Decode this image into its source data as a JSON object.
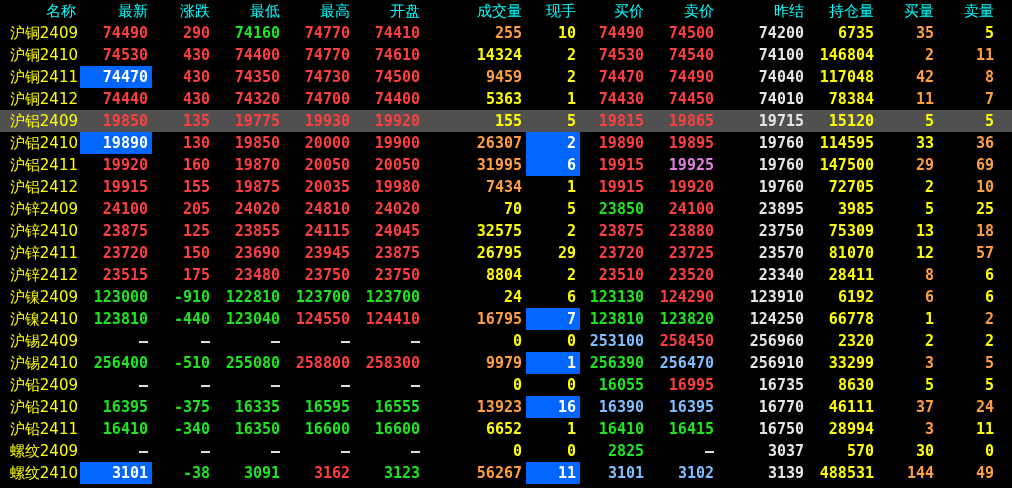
{
  "columns": [
    "名称",
    "最新",
    "涨跌",
    "最低",
    "最高",
    "开盘",
    "成交量",
    "现手",
    "买价",
    "卖价",
    "昨结",
    "持仓量",
    "买量",
    "卖量"
  ],
  "rows": [
    {
      "name": "沪铜2409",
      "selected": false,
      "cells": [
        {
          "text": "74490",
          "color": "#ff3f3f",
          "highlighted": false
        },
        {
          "text": "290",
          "color": "#ff3f3f",
          "highlighted": false
        },
        {
          "text": "74160",
          "color": "#1ee61e",
          "highlighted": false
        },
        {
          "text": "74770",
          "color": "#ff3f3f",
          "highlighted": false
        },
        {
          "text": "74410",
          "color": "#ff3f3f",
          "highlighted": false
        },
        {
          "text": "255",
          "color": "#ff9f40",
          "highlighted": false
        },
        {
          "text": "10",
          "color": "#ffff00",
          "highlighted": false
        },
        {
          "text": "74490",
          "color": "#ff3f3f",
          "highlighted": false
        },
        {
          "text": "74500",
          "color": "#ff3f3f",
          "highlighted": false
        },
        {
          "text": "74200",
          "color": "#e6e6e6",
          "highlighted": false
        },
        {
          "text": "6735",
          "color": "#ffff00",
          "highlighted": false
        },
        {
          "text": "35",
          "color": "#ff9f40",
          "highlighted": false
        },
        {
          "text": "5",
          "color": "#ffff00",
          "highlighted": false
        }
      ]
    },
    {
      "name": "沪铜2410",
      "selected": false,
      "cells": [
        {
          "text": "74530",
          "color": "#ff3f3f",
          "highlighted": false
        },
        {
          "text": "430",
          "color": "#ff3f3f",
          "highlighted": false
        },
        {
          "text": "74400",
          "color": "#ff3f3f",
          "highlighted": false
        },
        {
          "text": "74770",
          "color": "#ff3f3f",
          "highlighted": false
        },
        {
          "text": "74610",
          "color": "#ff3f3f",
          "highlighted": false
        },
        {
          "text": "14324",
          "color": "#ffff00",
          "highlighted": false
        },
        {
          "text": "2",
          "color": "#ffff00",
          "highlighted": false
        },
        {
          "text": "74530",
          "color": "#ff3f3f",
          "highlighted": false
        },
        {
          "text": "74540",
          "color": "#ff3f3f",
          "highlighted": false
        },
        {
          "text": "74100",
          "color": "#e6e6e6",
          "highlighted": false
        },
        {
          "text": "146804",
          "color": "#ffff00",
          "highlighted": false
        },
        {
          "text": "2",
          "color": "#ff9f40",
          "highlighted": false
        },
        {
          "text": "11",
          "color": "#ff9f40",
          "highlighted": false
        }
      ]
    },
    {
      "name": "沪铜2411",
      "selected": false,
      "cells": [
        {
          "text": "74470",
          "color": "#ffffff",
          "highlighted": true
        },
        {
          "text": "430",
          "color": "#ff3f3f",
          "highlighted": false
        },
        {
          "text": "74350",
          "color": "#ff3f3f",
          "highlighted": false
        },
        {
          "text": "74730",
          "color": "#ff3f3f",
          "highlighted": false
        },
        {
          "text": "74500",
          "color": "#ff3f3f",
          "highlighted": false
        },
        {
          "text": "9459",
          "color": "#ff9f40",
          "highlighted": false
        },
        {
          "text": "2",
          "color": "#ffff00",
          "highlighted": false
        },
        {
          "text": "74470",
          "color": "#ff3f3f",
          "highlighted": false
        },
        {
          "text": "74490",
          "color": "#ff3f3f",
          "highlighted": false
        },
        {
          "text": "74040",
          "color": "#e6e6e6",
          "highlighted": false
        },
        {
          "text": "117048",
          "color": "#ffff00",
          "highlighted": false
        },
        {
          "text": "42",
          "color": "#ff9f40",
          "highlighted": false
        },
        {
          "text": "8",
          "color": "#ff9f40",
          "highlighted": false
        }
      ]
    },
    {
      "name": "沪铜2412",
      "selected": false,
      "cells": [
        {
          "text": "74440",
          "color": "#ff3f3f",
          "highlighted": false
        },
        {
          "text": "430",
          "color": "#ff3f3f",
          "highlighted": false
        },
        {
          "text": "74320",
          "color": "#ff3f3f",
          "highlighted": false
        },
        {
          "text": "74700",
          "color": "#ff3f3f",
          "highlighted": false
        },
        {
          "text": "74400",
          "color": "#ff3f3f",
          "highlighted": false
        },
        {
          "text": "5363",
          "color": "#ffff00",
          "highlighted": false
        },
        {
          "text": "1",
          "color": "#ffff00",
          "highlighted": false
        },
        {
          "text": "74430",
          "color": "#ff3f3f",
          "highlighted": false
        },
        {
          "text": "74450",
          "color": "#ff3f3f",
          "highlighted": false
        },
        {
          "text": "74010",
          "color": "#e6e6e6",
          "highlighted": false
        },
        {
          "text": "78384",
          "color": "#ffff00",
          "highlighted": false
        },
        {
          "text": "11",
          "color": "#ff9f40",
          "highlighted": false
        },
        {
          "text": "7",
          "color": "#ff9f40",
          "highlighted": false
        }
      ]
    },
    {
      "name": "沪铝2409",
      "selected": true,
      "cells": [
        {
          "text": "19850",
          "color": "#ff3f3f",
          "highlighted": false
        },
        {
          "text": "135",
          "color": "#ff3f3f",
          "highlighted": false
        },
        {
          "text": "19775",
          "color": "#ff3f3f",
          "highlighted": false
        },
        {
          "text": "19930",
          "color": "#ff3f3f",
          "highlighted": false
        },
        {
          "text": "19920",
          "color": "#ff3f3f",
          "highlighted": false
        },
        {
          "text": "155",
          "color": "#ffff00",
          "highlighted": false
        },
        {
          "text": "5",
          "color": "#ffff00",
          "highlighted": false
        },
        {
          "text": "19815",
          "color": "#ff3f3f",
          "highlighted": false
        },
        {
          "text": "19865",
          "color": "#ff3f3f",
          "highlighted": false
        },
        {
          "text": "19715",
          "color": "#e6e6e6",
          "highlighted": false
        },
        {
          "text": "15120",
          "color": "#ffff00",
          "highlighted": false
        },
        {
          "text": "5",
          "color": "#ffff00",
          "highlighted": false
        },
        {
          "text": "5",
          "color": "#ffff00",
          "highlighted": false
        }
      ]
    },
    {
      "name": "沪铝2410",
      "selected": false,
      "cells": [
        {
          "text": "19890",
          "color": "#ffffff",
          "highlighted": true
        },
        {
          "text": "130",
          "color": "#ff3f3f",
          "highlighted": false
        },
        {
          "text": "19850",
          "color": "#ff3f3f",
          "highlighted": false
        },
        {
          "text": "20000",
          "color": "#ff3f3f",
          "highlighted": false
        },
        {
          "text": "19900",
          "color": "#ff3f3f",
          "highlighted": false
        },
        {
          "text": "26307",
          "color": "#ff9f40",
          "highlighted": false
        },
        {
          "text": "2",
          "color": "#ffffff",
          "highlighted": true
        },
        {
          "text": "19890",
          "color": "#ff3f3f",
          "highlighted": false
        },
        {
          "text": "19895",
          "color": "#ff3f3f",
          "highlighted": false
        },
        {
          "text": "19760",
          "color": "#e6e6e6",
          "highlighted": false
        },
        {
          "text": "114595",
          "color": "#ffff00",
          "highlighted": false
        },
        {
          "text": "33",
          "color": "#ffff00",
          "highlighted": false
        },
        {
          "text": "36",
          "color": "#ff9f40",
          "highlighted": false
        }
      ]
    },
    {
      "name": "沪铝2411",
      "selected": false,
      "cells": [
        {
          "text": "19920",
          "color": "#ff3f3f",
          "highlighted": false
        },
        {
          "text": "160",
          "color": "#ff3f3f",
          "highlighted": false
        },
        {
          "text": "19870",
          "color": "#ff3f3f",
          "highlighted": false
        },
        {
          "text": "20050",
          "color": "#ff3f3f",
          "highlighted": false
        },
        {
          "text": "20050",
          "color": "#ff3f3f",
          "highlighted": false
        },
        {
          "text": "31995",
          "color": "#ff9f40",
          "highlighted": false
        },
        {
          "text": "6",
          "color": "#ffffff",
          "highlighted": true
        },
        {
          "text": "19915",
          "color": "#ff3f3f",
          "highlighted": false
        },
        {
          "text": "19925",
          "color": "#e080e0",
          "highlighted": false
        },
        {
          "text": "19760",
          "color": "#e6e6e6",
          "highlighted": false
        },
        {
          "text": "147500",
          "color": "#ffff00",
          "highlighted": false
        },
        {
          "text": "29",
          "color": "#ff9f40",
          "highlighted": false
        },
        {
          "text": "69",
          "color": "#ff9f40",
          "highlighted": false
        }
      ]
    },
    {
      "name": "沪铝2412",
      "selected": false,
      "cells": [
        {
          "text": "19915",
          "color": "#ff3f3f",
          "highlighted": false
        },
        {
          "text": "155",
          "color": "#ff3f3f",
          "highlighted": false
        },
        {
          "text": "19875",
          "color": "#ff3f3f",
          "highlighted": false
        },
        {
          "text": "20035",
          "color": "#ff3f3f",
          "highlighted": false
        },
        {
          "text": "19980",
          "color": "#ff3f3f",
          "highlighted": false
        },
        {
          "text": "7434",
          "color": "#ff9f40",
          "highlighted": false
        },
        {
          "text": "1",
          "color": "#ffff00",
          "highlighted": false
        },
        {
          "text": "19915",
          "color": "#ff3f3f",
          "highlighted": false
        },
        {
          "text": "19920",
          "color": "#ff3f3f",
          "highlighted": false
        },
        {
          "text": "19760",
          "color": "#e6e6e6",
          "highlighted": false
        },
        {
          "text": "72705",
          "color": "#ffff00",
          "highlighted": false
        },
        {
          "text": "2",
          "color": "#ffff00",
          "highlighted": false
        },
        {
          "text": "10",
          "color": "#ff9f40",
          "highlighted": false
        }
      ]
    },
    {
      "name": "沪锌2409",
      "selected": false,
      "cells": [
        {
          "text": "24100",
          "color": "#ff3f3f",
          "highlighted": false
        },
        {
          "text": "205",
          "color": "#ff3f3f",
          "highlighted": false
        },
        {
          "text": "24020",
          "color": "#ff3f3f",
          "highlighted": false
        },
        {
          "text": "24810",
          "color": "#ff3f3f",
          "highlighted": false
        },
        {
          "text": "24020",
          "color": "#ff3f3f",
          "highlighted": false
        },
        {
          "text": "70",
          "color": "#ffff00",
          "highlighted": false
        },
        {
          "text": "5",
          "color": "#ffff00",
          "highlighted": false
        },
        {
          "text": "23850",
          "color": "#1ee61e",
          "highlighted": false
        },
        {
          "text": "24100",
          "color": "#ff3f3f",
          "highlighted": false
        },
        {
          "text": "23895",
          "color": "#e6e6e6",
          "highlighted": false
        },
        {
          "text": "3985",
          "color": "#ffff00",
          "highlighted": false
        },
        {
          "text": "5",
          "color": "#ffff00",
          "highlighted": false
        },
        {
          "text": "25",
          "color": "#ffff00",
          "highlighted": false
        }
      ]
    },
    {
      "name": "沪锌2410",
      "selected": false,
      "cells": [
        {
          "text": "23875",
          "color": "#ff3f3f",
          "highlighted": false
        },
        {
          "text": "125",
          "color": "#ff3f3f",
          "highlighted": false
        },
        {
          "text": "23855",
          "color": "#ff3f3f",
          "highlighted": false
        },
        {
          "text": "24115",
          "color": "#ff3f3f",
          "highlighted": false
        },
        {
          "text": "24045",
          "color": "#ff3f3f",
          "highlighted": false
        },
        {
          "text": "32575",
          "color": "#ffff00",
          "highlighted": false
        },
        {
          "text": "2",
          "color": "#ffff00",
          "highlighted": false
        },
        {
          "text": "23875",
          "color": "#ff3f3f",
          "highlighted": false
        },
        {
          "text": "23880",
          "color": "#ff3f3f",
          "highlighted": false
        },
        {
          "text": "23750",
          "color": "#e6e6e6",
          "highlighted": false
        },
        {
          "text": "75309",
          "color": "#ffff00",
          "highlighted": false
        },
        {
          "text": "13",
          "color": "#ffff00",
          "highlighted": false
        },
        {
          "text": "18",
          "color": "#ff9f40",
          "highlighted": false
        }
      ]
    },
    {
      "name": "沪锌2411",
      "selected": false,
      "cells": [
        {
          "text": "23720",
          "color": "#ff3f3f",
          "highlighted": false
        },
        {
          "text": "150",
          "color": "#ff3f3f",
          "highlighted": false
        },
        {
          "text": "23690",
          "color": "#ff3f3f",
          "highlighted": false
        },
        {
          "text": "23945",
          "color": "#ff3f3f",
          "highlighted": false
        },
        {
          "text": "23875",
          "color": "#ff3f3f",
          "highlighted": false
        },
        {
          "text": "26795",
          "color": "#ffff00",
          "highlighted": false
        },
        {
          "text": "29",
          "color": "#ffff00",
          "highlighted": false
        },
        {
          "text": "23720",
          "color": "#ff3f3f",
          "highlighted": false
        },
        {
          "text": "23725",
          "color": "#ff3f3f",
          "highlighted": false
        },
        {
          "text": "23570",
          "color": "#e6e6e6",
          "highlighted": false
        },
        {
          "text": "81070",
          "color": "#ffff00",
          "highlighted": false
        },
        {
          "text": "12",
          "color": "#ffff00",
          "highlighted": false
        },
        {
          "text": "57",
          "color": "#ff9f40",
          "highlighted": false
        }
      ]
    },
    {
      "name": "沪锌2412",
      "selected": false,
      "cells": [
        {
          "text": "23515",
          "color": "#ff3f3f",
          "highlighted": false
        },
        {
          "text": "175",
          "color": "#ff3f3f",
          "highlighted": false
        },
        {
          "text": "23480",
          "color": "#ff3f3f",
          "highlighted": false
        },
        {
          "text": "23750",
          "color": "#ff3f3f",
          "highlighted": false
        },
        {
          "text": "23750",
          "color": "#ff3f3f",
          "highlighted": false
        },
        {
          "text": "8804",
          "color": "#ffff00",
          "highlighted": false
        },
        {
          "text": "2",
          "color": "#ffff00",
          "highlighted": false
        },
        {
          "text": "23510",
          "color": "#ff3f3f",
          "highlighted": false
        },
        {
          "text": "23520",
          "color": "#ff3f3f",
          "highlighted": false
        },
        {
          "text": "23340",
          "color": "#e6e6e6",
          "highlighted": false
        },
        {
          "text": "28411",
          "color": "#ffff00",
          "highlighted": false
        },
        {
          "text": "8",
          "color": "#ff9f40",
          "highlighted": false
        },
        {
          "text": "6",
          "color": "#ffff00",
          "highlighted": false
        }
      ]
    },
    {
      "name": "沪镍2409",
      "selected": false,
      "cells": [
        {
          "text": "123000",
          "color": "#1ee61e",
          "highlighted": false
        },
        {
          "text": "-910",
          "color": "#1ee61e",
          "highlighted": false
        },
        {
          "text": "122810",
          "color": "#1ee61e",
          "highlighted": false
        },
        {
          "text": "123700",
          "color": "#1ee61e",
          "highlighted": false
        },
        {
          "text": "123700",
          "color": "#1ee61e",
          "highlighted": false
        },
        {
          "text": "24",
          "color": "#ffff00",
          "highlighted": false
        },
        {
          "text": "6",
          "color": "#ffff00",
          "highlighted": false
        },
        {
          "text": "123130",
          "color": "#1ee61e",
          "highlighted": false
        },
        {
          "text": "124290",
          "color": "#ff3f3f",
          "highlighted": false
        },
        {
          "text": "123910",
          "color": "#e6e6e6",
          "highlighted": false
        },
        {
          "text": "6192",
          "color": "#ffff00",
          "highlighted": false
        },
        {
          "text": "6",
          "color": "#ff9f40",
          "highlighted": false
        },
        {
          "text": "6",
          "color": "#ffff00",
          "highlighted": false
        }
      ]
    },
    {
      "name": "沪镍2410",
      "selected": false,
      "cells": [
        {
          "text": "123810",
          "color": "#1ee61e",
          "highlighted": false
        },
        {
          "text": "-440",
          "color": "#1ee61e",
          "highlighted": false
        },
        {
          "text": "123040",
          "color": "#1ee61e",
          "highlighted": false
        },
        {
          "text": "124550",
          "color": "#ff3f3f",
          "highlighted": false
        },
        {
          "text": "124410",
          "color": "#ff3f3f",
          "highlighted": false
        },
        {
          "text": "16795",
          "color": "#ff9f40",
          "highlighted": false
        },
        {
          "text": "7",
          "color": "#ffffff",
          "highlighted": true
        },
        {
          "text": "123810",
          "color": "#1ee61e",
          "highlighted": false
        },
        {
          "text": "123820",
          "color": "#1ee61e",
          "highlighted": false
        },
        {
          "text": "124250",
          "color": "#e6e6e6",
          "highlighted": false
        },
        {
          "text": "66778",
          "color": "#ffff00",
          "highlighted": false
        },
        {
          "text": "1",
          "color": "#ffff00",
          "highlighted": false
        },
        {
          "text": "2",
          "color": "#ff9f40",
          "highlighted": false
        }
      ]
    },
    {
      "name": "沪锡2409",
      "selected": false,
      "cells": [
        {
          "text": "—",
          "color": "#e6e6e6",
          "highlighted": false
        },
        {
          "text": "—",
          "color": "#e6e6e6",
          "highlighted": false
        },
        {
          "text": "—",
          "color": "#e6e6e6",
          "highlighted": false
        },
        {
          "text": "—",
          "color": "#e6e6e6",
          "highlighted": false
        },
        {
          "text": "—",
          "color": "#e6e6e6",
          "highlighted": false
        },
        {
          "text": "0",
          "color": "#ffff00",
          "highlighted": false
        },
        {
          "text": "0",
          "color": "#ffff00",
          "highlighted": false
        },
        {
          "text": "253100",
          "color": "#80bfff",
          "highlighted": false
        },
        {
          "text": "258450",
          "color": "#ff3f3f",
          "highlighted": false
        },
        {
          "text": "256960",
          "color": "#e6e6e6",
          "highlighted": false
        },
        {
          "text": "2320",
          "color": "#ffff00",
          "highlighted": false
        },
        {
          "text": "2",
          "color": "#ffff00",
          "highlighted": false
        },
        {
          "text": "2",
          "color": "#ffff00",
          "highlighted": false
        }
      ]
    },
    {
      "name": "沪锡2410",
      "selected": false,
      "cells": [
        {
          "text": "256400",
          "color": "#1ee61e",
          "highlighted": false
        },
        {
          "text": "-510",
          "color": "#1ee61e",
          "highlighted": false
        },
        {
          "text": "255080",
          "color": "#1ee61e",
          "highlighted": false
        },
        {
          "text": "258800",
          "color": "#ff3f3f",
          "highlighted": false
        },
        {
          "text": "258300",
          "color": "#ff3f3f",
          "highlighted": false
        },
        {
          "text": "9979",
          "color": "#ff9f40",
          "highlighted": false
        },
        {
          "text": "1",
          "color": "#ffffff",
          "highlighted": true
        },
        {
          "text": "256390",
          "color": "#1ee61e",
          "highlighted": false
        },
        {
          "text": "256470",
          "color": "#80bfff",
          "highlighted": false
        },
        {
          "text": "256910",
          "color": "#e6e6e6",
          "highlighted": false
        },
        {
          "text": "33299",
          "color": "#ffff00",
          "highlighted": false
        },
        {
          "text": "3",
          "color": "#ff9f40",
          "highlighted": false
        },
        {
          "text": "5",
          "color": "#ff9f40",
          "highlighted": false
        }
      ]
    },
    {
      "name": "沪铅2409",
      "selected": false,
      "cells": [
        {
          "text": "—",
          "color": "#e6e6e6",
          "highlighted": false
        },
        {
          "text": "—",
          "color": "#e6e6e6",
          "highlighted": false
        },
        {
          "text": "—",
          "color": "#e6e6e6",
          "highlighted": false
        },
        {
          "text": "—",
          "color": "#e6e6e6",
          "highlighted": false
        },
        {
          "text": "—",
          "color": "#e6e6e6",
          "highlighted": false
        },
        {
          "text": "0",
          "color": "#ffff00",
          "highlighted": false
        },
        {
          "text": "0",
          "color": "#ffff00",
          "highlighted": false
        },
        {
          "text": "16055",
          "color": "#1ee61e",
          "highlighted": false
        },
        {
          "text": "16995",
          "color": "#ff3f3f",
          "highlighted": false
        },
        {
          "text": "16735",
          "color": "#e6e6e6",
          "highlighted": false
        },
        {
          "text": "8630",
          "color": "#ffff00",
          "highlighted": false
        },
        {
          "text": "5",
          "color": "#ffff00",
          "highlighted": false
        },
        {
          "text": "5",
          "color": "#ffff00",
          "highlighted": false
        }
      ]
    },
    {
      "name": "沪铅2410",
      "selected": false,
      "cells": [
        {
          "text": "16395",
          "color": "#1ee61e",
          "highlighted": false
        },
        {
          "text": "-375",
          "color": "#1ee61e",
          "highlighted": false
        },
        {
          "text": "16335",
          "color": "#1ee61e",
          "highlighted": false
        },
        {
          "text": "16595",
          "color": "#1ee61e",
          "highlighted": false
        },
        {
          "text": "16555",
          "color": "#1ee61e",
          "highlighted": false
        },
        {
          "text": "13923",
          "color": "#ff9f40",
          "highlighted": false
        },
        {
          "text": "16",
          "color": "#ffffff",
          "highlighted": true
        },
        {
          "text": "16390",
          "color": "#80bfff",
          "highlighted": false
        },
        {
          "text": "16395",
          "color": "#80bfff",
          "highlighted": false
        },
        {
          "text": "16770",
          "color": "#e6e6e6",
          "highlighted": false
        },
        {
          "text": "46111",
          "color": "#ffff00",
          "highlighted": false
        },
        {
          "text": "37",
          "color": "#ff9f40",
          "highlighted": false
        },
        {
          "text": "24",
          "color": "#ff9f40",
          "highlighted": false
        }
      ]
    },
    {
      "name": "沪铅2411",
      "selected": false,
      "cells": [
        {
          "text": "16410",
          "color": "#1ee61e",
          "highlighted": false
        },
        {
          "text": "-340",
          "color": "#1ee61e",
          "highlighted": false
        },
        {
          "text": "16350",
          "color": "#1ee61e",
          "highlighted": false
        },
        {
          "text": "16600",
          "color": "#1ee61e",
          "highlighted": false
        },
        {
          "text": "16600",
          "color": "#1ee61e",
          "highlighted": false
        },
        {
          "text": "6652",
          "color": "#ffff00",
          "highlighted": false
        },
        {
          "text": "1",
          "color": "#ffff00",
          "highlighted": false
        },
        {
          "text": "16410",
          "color": "#1ee61e",
          "highlighted": false
        },
        {
          "text": "16415",
          "color": "#1ee61e",
          "highlighted": false
        },
        {
          "text": "16750",
          "color": "#e6e6e6",
          "highlighted": false
        },
        {
          "text": "28994",
          "color": "#ffff00",
          "highlighted": false
        },
        {
          "text": "3",
          "color": "#ff9f40",
          "highlighted": false
        },
        {
          "text": "11",
          "color": "#ffff00",
          "highlighted": false
        }
      ]
    },
    {
      "name": "螺纹2409",
      "selected": false,
      "cells": [
        {
          "text": "—",
          "color": "#e6e6e6",
          "highlighted": false
        },
        {
          "text": "—",
          "color": "#e6e6e6",
          "highlighted": false
        },
        {
          "text": "—",
          "color": "#e6e6e6",
          "highlighted": false
        },
        {
          "text": "—",
          "color": "#e6e6e6",
          "highlighted": false
        },
        {
          "text": "—",
          "color": "#e6e6e6",
          "highlighted": false
        },
        {
          "text": "0",
          "color": "#ffff00",
          "highlighted": false
        },
        {
          "text": "0",
          "color": "#ffff00",
          "highlighted": false
        },
        {
          "text": "2825",
          "color": "#1ee61e",
          "highlighted": false
        },
        {
          "text": "—",
          "color": "#e6e6e6",
          "highlighted": false
        },
        {
          "text": "3037",
          "color": "#e6e6e6",
          "highlighted": false
        },
        {
          "text": "570",
          "color": "#ffff00",
          "highlighted": false
        },
        {
          "text": "30",
          "color": "#ffff00",
          "highlighted": false
        },
        {
          "text": "0",
          "color": "#ffff00",
          "highlighted": false
        }
      ]
    },
    {
      "name": "螺纹2410",
      "selected": false,
      "cells": [
        {
          "text": "3101",
          "color": "#ffffff",
          "highlighted": true
        },
        {
          "text": "-38",
          "color": "#1ee61e",
          "highlighted": false
        },
        {
          "text": "3091",
          "color": "#1ee61e",
          "highlighted": false
        },
        {
          "text": "3162",
          "color": "#ff3f3f",
          "highlighted": false
        },
        {
          "text": "3123",
          "color": "#1ee61e",
          "highlighted": false
        },
        {
          "text": "56267",
          "color": "#ff9f40",
          "highlighted": false
        },
        {
          "text": "11",
          "color": "#ffffff",
          "highlighted": true
        },
        {
          "text": "3101",
          "color": "#80bfff",
          "highlighted": false
        },
        {
          "text": "3102",
          "color": "#80bfff",
          "highlighted": false
        },
        {
          "text": "3139",
          "color": "#e6e6e6",
          "highlighted": false
        },
        {
          "text": "488531",
          "color": "#ffff00",
          "highlighted": false
        },
        {
          "text": "144",
          "color": "#ff9f40",
          "highlighted": false
        },
        {
          "text": "49",
          "color": "#ff9f40",
          "highlighted": false
        }
      ]
    }
  ]
}
